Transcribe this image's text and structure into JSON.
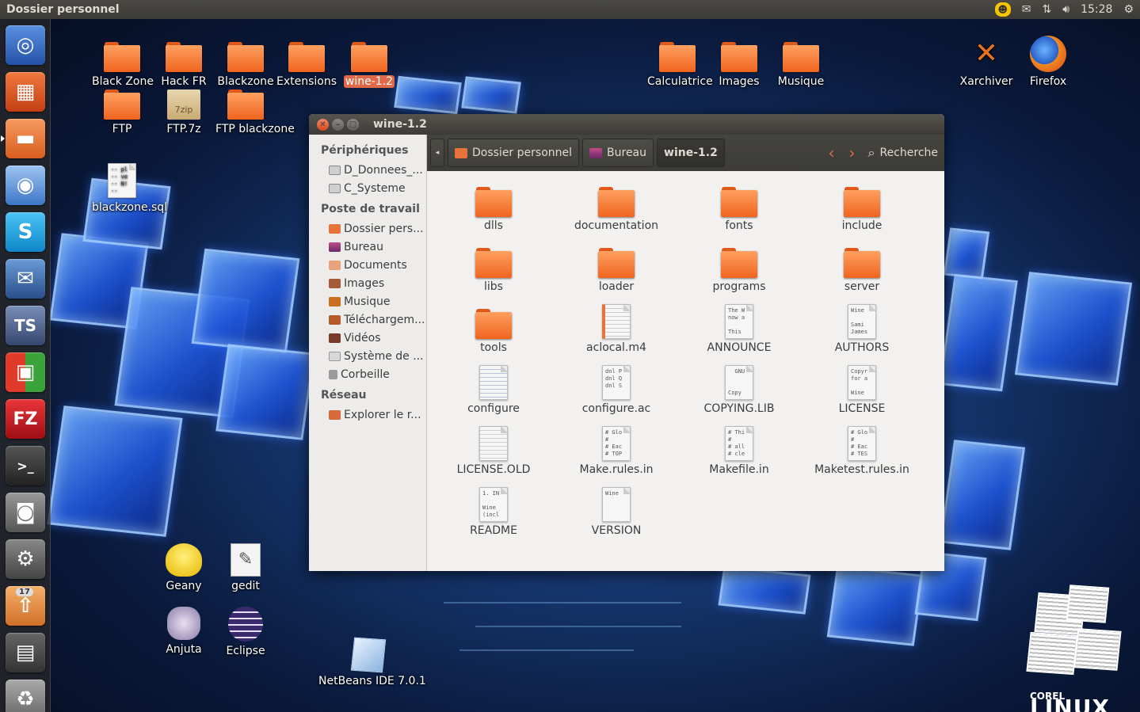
{
  "top_panel": {
    "title": "Dossier personnel",
    "time": "15:28",
    "icons": [
      "chat-icon",
      "mail-icon",
      "network-icon",
      "volume-icon",
      "settings-icon"
    ]
  },
  "launcher": {
    "items": [
      {
        "name": "ubuntu-dash",
        "glyph": "◎",
        "color": "#3a7ad8"
      },
      {
        "name": "software-center",
        "glyph": "▦",
        "color": "#d8562a"
      },
      {
        "name": "files",
        "glyph": "▬",
        "color": "#e8733a"
      },
      {
        "name": "chromium",
        "glyph": "◉",
        "color": "#5a8fd6"
      },
      {
        "name": "skype",
        "glyph": "S",
        "color": "#1aa7e6"
      },
      {
        "name": "thunderbird",
        "glyph": "✉",
        "color": "#3568a8"
      },
      {
        "name": "teamspeak",
        "glyph": "TS",
        "color": "#455a8a"
      },
      {
        "name": "apps-grid",
        "glyph": "▣",
        "color": "#3aa33a"
      },
      {
        "name": "filezilla",
        "glyph": "FZ",
        "color": "#c4161c"
      },
      {
        "name": "terminal",
        "glyph": ">_",
        "color": "#333333"
      },
      {
        "name": "camera",
        "glyph": "◙",
        "color": "#666666"
      },
      {
        "name": "system-settings",
        "glyph": "⚙",
        "color": "#555555"
      },
      {
        "name": "update-manager",
        "glyph": "⇧",
        "color": "#e48a3a"
      },
      {
        "name": "workspace-switcher",
        "glyph": "▤",
        "color": "#444444"
      },
      {
        "name": "trash",
        "glyph": "♻",
        "color": "#777777"
      }
    ],
    "update_badge": "17"
  },
  "desktop": {
    "icons": [
      {
        "label": "Black Zone",
        "type": "folder"
      },
      {
        "label": "Hack FR",
        "type": "folder"
      },
      {
        "label": "Blackzone",
        "type": "folder"
      },
      {
        "label": "Extensions",
        "type": "folder"
      },
      {
        "label": "wine-1.2",
        "type": "folder",
        "selected": true
      },
      {
        "label": "FTP",
        "type": "folder"
      },
      {
        "label": "FTP.7z",
        "type": "archive"
      },
      {
        "label": "FTP blackzone",
        "type": "folder"
      },
      {
        "label": "Calculatrice",
        "type": "folder"
      },
      {
        "label": "Images",
        "type": "folder"
      },
      {
        "label": "Musique",
        "type": "folder"
      },
      {
        "label": "Xarchiver",
        "type": "app"
      },
      {
        "label": "Firefox",
        "type": "app"
      },
      {
        "label": "blackzone.sql",
        "type": "doc"
      },
      {
        "label": "Geany",
        "type": "app"
      },
      {
        "label": "gedit",
        "type": "app"
      },
      {
        "label": "Anjuta",
        "type": "app"
      },
      {
        "label": "Eclipse",
        "type": "app"
      },
      {
        "label": "NetBeans IDE 7.0.1",
        "type": "app"
      }
    ],
    "archive_tag": "7zip",
    "sql_preview": "-- pl\n-- ve\n-- N!\n--",
    "corel_text": "COREL",
    "linux_text": "LINUX"
  },
  "window": {
    "title": "wine-1.2",
    "sidebar": {
      "sections": [
        {
          "heading": "Périphériques",
          "items": [
            "D_Donnees_...",
            "C_Systeme"
          ]
        },
        {
          "heading": "Poste de travail",
          "items": [
            "Dossier pers...",
            "Bureau",
            "Documents",
            "Images",
            "Musique",
            "Téléchargem...",
            "Vidéos",
            "Système de ...",
            "Corbeille"
          ]
        },
        {
          "heading": "Réseau",
          "items": [
            "Explorer le r..."
          ]
        }
      ]
    },
    "breadcrumbs": [
      "Dossier personnel",
      "Bureau",
      "wine-1.2"
    ],
    "search_label": "Recherche",
    "files": [
      {
        "name": "dlls",
        "type": "folder"
      },
      {
        "name": "documentation",
        "type": "folder"
      },
      {
        "name": "fonts",
        "type": "folder"
      },
      {
        "name": "include",
        "type": "folder"
      },
      {
        "name": "libs",
        "type": "folder"
      },
      {
        "name": "loader",
        "type": "folder"
      },
      {
        "name": "programs",
        "type": "folder"
      },
      {
        "name": "server",
        "type": "folder"
      },
      {
        "name": "tools",
        "type": "folder"
      },
      {
        "name": "aclocal.m4",
        "type": "doc",
        "preview": ""
      },
      {
        "name": "ANNOUNCE",
        "type": "doc",
        "preview": "The W\nnow a\n\nThis"
      },
      {
        "name": "AUTHORS",
        "type": "doc",
        "preview": "Wine\n\nSami\nJames"
      },
      {
        "name": "configure",
        "type": "doc",
        "preview": ""
      },
      {
        "name": "configure.ac",
        "type": "doc",
        "preview": "dnl P\ndnl Q\ndnl S"
      },
      {
        "name": "COPYING.LIB",
        "type": "doc",
        "preview": "  GNU\n\n\nCopy"
      },
      {
        "name": "LICENSE",
        "type": "doc",
        "preview": "Copyr\nfor a\n\nWine"
      },
      {
        "name": "LICENSE.OLD",
        "type": "doc",
        "preview": ""
      },
      {
        "name": "Make.rules.in",
        "type": "doc",
        "preview": "# Glo\n#\n# Eac\n# TOP"
      },
      {
        "name": "Makefile.in",
        "type": "doc",
        "preview": "# Thi\n#\n# all\n# cle"
      },
      {
        "name": "Maketest.rules.in",
        "type": "doc",
        "preview": "# Glo\n#\n# Eac\n# TES"
      },
      {
        "name": "README",
        "type": "doc",
        "preview": "1. IN\n\nWine\n(incl"
      },
      {
        "name": "VERSION",
        "type": "doc",
        "preview": "Wine"
      }
    ]
  }
}
